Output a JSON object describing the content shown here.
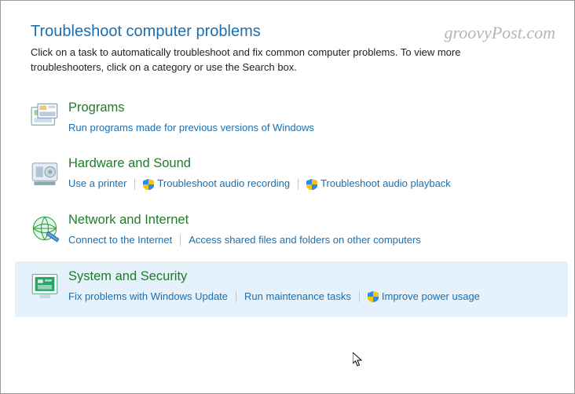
{
  "watermark": "groovyPost.com",
  "header": {
    "title": "Troubleshoot computer problems",
    "description": "Click on a task to automatically troubleshoot and fix common computer problems. To view more troubleshooters, click on a category or use the Search box."
  },
  "categories": [
    {
      "id": "programs",
      "title": "Programs",
      "hovered": false,
      "tasks": [
        {
          "label": "Run programs made for previous versions of Windows",
          "shield": false
        }
      ]
    },
    {
      "id": "hardware",
      "title": "Hardware and Sound",
      "hovered": false,
      "tasks": [
        {
          "label": "Use a printer",
          "shield": false
        },
        {
          "label": "Troubleshoot audio recording",
          "shield": true
        },
        {
          "label": "Troubleshoot audio playback",
          "shield": true
        }
      ]
    },
    {
      "id": "network",
      "title": "Network and Internet",
      "hovered": false,
      "tasks": [
        {
          "label": "Connect to the Internet",
          "shield": false
        },
        {
          "label": "Access shared files and folders on other computers",
          "shield": false
        }
      ]
    },
    {
      "id": "system",
      "title": "System and Security",
      "hovered": true,
      "tasks": [
        {
          "label": "Fix problems with Windows Update",
          "shield": false
        },
        {
          "label": "Run maintenance tasks",
          "shield": false
        },
        {
          "label": "Improve power usage",
          "shield": true
        }
      ]
    }
  ]
}
